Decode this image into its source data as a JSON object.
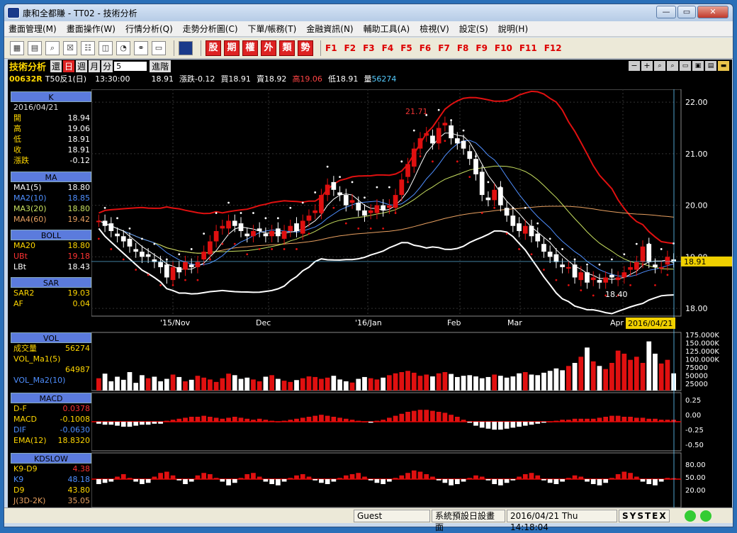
{
  "window": {
    "title": "康和全都賺 - TT02 - 技術分析",
    "min": "—",
    "max": "▭",
    "close": "✕"
  },
  "menus": [
    "畫面管理(M)",
    "畫面操作(W)",
    "行情分析(Q)",
    "走勢分析圖(C)",
    "下單/帳務(T)",
    "金融資訊(N)",
    "輔助工具(A)",
    "檢視(V)",
    "設定(S)",
    "說明(H)"
  ],
  "toolbar": {
    "red_buttons": [
      "股",
      "期",
      "權",
      "外",
      "類",
      "勢"
    ],
    "fkeys": [
      "F1",
      "F2",
      "F3",
      "F4",
      "F5",
      "F6",
      "F7",
      "F8",
      "F9",
      "F10",
      "F11",
      "F12"
    ]
  },
  "header": {
    "title": "技術分析",
    "tabs": [
      "還",
      "日",
      "週",
      "月",
      "分"
    ],
    "period_value": "5",
    "advanced": "進階"
  },
  "quote": {
    "code": "00632R",
    "name": "T50反1(日)",
    "time": "13:30:00",
    "price": "18.91",
    "change": "漲跌-0.12",
    "bid": "買18.91",
    "ask": "賣18.92",
    "high": "高19.06",
    "low": "低18.91",
    "volume_label": "量",
    "volume": "56274"
  },
  "colors": {
    "up": "#e01010",
    "down": "#ffffff",
    "ma1": "#ffffff",
    "ma2": "#4f8fff",
    "ma3": "#c8e060",
    "ma4": "#e8a060",
    "boll": "#e01010",
    "sar": "#ffffff",
    "label_bg": "#f0d000"
  },
  "side": {
    "k": {
      "head": "K",
      "date": "2016/04/21",
      "rows": [
        [
          "開",
          "18.94"
        ],
        [
          "高",
          "19.06"
        ],
        [
          "低",
          "18.91"
        ],
        [
          "收",
          "18.91"
        ],
        [
          "漲跌",
          "-0.12"
        ]
      ]
    },
    "ma": {
      "head": "MA",
      "rows": [
        [
          "MA1(5)",
          "18.80"
        ],
        [
          "MA2(10)",
          "18.85"
        ],
        [
          "MA3(20)",
          "18.80"
        ],
        [
          "MA4(60)",
          "19.42"
        ]
      ]
    },
    "boll": {
      "head": "BOLL",
      "rows": [
        [
          "MA20",
          "18.80"
        ],
        [
          "UBt",
          "19.18"
        ],
        [
          "LBt",
          "18.43"
        ]
      ]
    },
    "sar": {
      "head": "SAR",
      "rows": [
        [
          "SAR2",
          "19.03"
        ],
        [
          "AF",
          "0.04"
        ]
      ]
    },
    "vol": {
      "head": "VOL",
      "rows": [
        [
          "成交量",
          "56274"
        ],
        [
          "VOL_Ma1(5)",
          ""
        ],
        [
          "",
          "64987"
        ],
        [
          "VOL_Ma2(10)",
          ""
        ]
      ]
    },
    "macd": {
      "head": "MACD",
      "rows": [
        [
          "D-F",
          "0.0378"
        ],
        [
          "MACD",
          "-0.1008"
        ],
        [
          "DIF",
          "-0.0630"
        ],
        [
          "EMA(12)",
          "18.8320"
        ]
      ]
    },
    "kd": {
      "head": "KDSLOW",
      "rows": [
        [
          "K9-D9",
          "4.38"
        ],
        [
          "K9",
          "48.18"
        ],
        [
          "D9",
          "43.80"
        ],
        [
          "J(3D-2K)",
          "35.05"
        ]
      ]
    }
  },
  "chart_data": {
    "type": "candlestick",
    "price_axis": [
      "22.00",
      "21.00",
      "20.00",
      "19.00",
      "18.00"
    ],
    "price_range": [
      17.85,
      22.25
    ],
    "x_labels": [
      "'15/Nov",
      "Dec",
      "'16/Jan",
      "Feb",
      "Mar",
      "Apr"
    ],
    "cursor_date": "2016/04/21",
    "current_price": "18.91",
    "annotations": [
      {
        "text": "21.71"
      },
      {
        "text": "18.40"
      }
    ],
    "vol_axis": [
      "175.000K",
      "150.000K",
      "125.000K",
      "100.000K",
      "75000",
      "50000",
      "25000"
    ],
    "macd_axis": [
      "0.25",
      "0.00",
      "-0.25",
      "-0.50"
    ],
    "kd_axis": [
      "80.00",
      "50.00",
      "20.00"
    ],
    "closes": [
      19.7,
      19.6,
      19.5,
      19.4,
      19.3,
      19.2,
      19.1,
      19.0,
      19.0,
      18.9,
      18.8,
      18.6,
      18.8,
      18.7,
      18.9,
      18.8,
      18.9,
      19.1,
      19.3,
      19.5,
      19.6,
      19.7,
      19.6,
      19.5,
      19.4,
      19.5,
      19.5,
      19.4,
      19.5,
      19.4,
      19.5,
      19.6,
      19.5,
      19.7,
      19.8,
      19.9,
      20.2,
      20.4,
      20.3,
      20.2,
      20.0,
      20.1,
      19.9,
      19.8,
      19.9,
      20.0,
      19.9,
      20.0,
      20.2,
      20.5,
      20.8,
      21.1,
      21.3,
      21.4,
      21.2,
      21.5,
      21.6,
      21.3,
      21.2,
      21.1,
      20.9,
      20.6,
      20.2,
      20.1,
      20.3,
      20.0,
      19.8,
      19.6,
      19.5,
      19.6,
      19.4,
      19.3,
      19.1,
      19.0,
      18.9,
      18.8,
      18.8,
      18.6,
      18.7,
      18.5,
      18.6,
      18.5,
      18.6,
      18.6,
      18.6,
      18.7,
      18.8,
      18.9,
      19.2,
      18.9,
      18.8,
      18.8,
      19.0,
      18.91
    ],
    "volumes": [
      40,
      55,
      30,
      45,
      35,
      60,
      25,
      50,
      40,
      45,
      30,
      38,
      52,
      44,
      30,
      35,
      48,
      42,
      36,
      28,
      40,
      55,
      50,
      38,
      42,
      36,
      30,
      45,
      50,
      38,
      32,
      28,
      34,
      40,
      46,
      44,
      38,
      42,
      48,
      36,
      30,
      26,
      38,
      44,
      40,
      36,
      42,
      50,
      56,
      60,
      64,
      58,
      48,
      52,
      46,
      56,
      60,
      54,
      44,
      48,
      50,
      46,
      40,
      44,
      52,
      48,
      42,
      46,
      56,
      60,
      52,
      50,
      58,
      64,
      72,
      66,
      80,
      90,
      110,
      140,
      95,
      80,
      70,
      90,
      130,
      120,
      100,
      110,
      90,
      160,
      120,
      88,
      100,
      56
    ],
    "macd_bars": [
      -0.02,
      -0.03,
      -0.03,
      -0.04,
      -0.05,
      -0.05,
      -0.04,
      -0.03,
      -0.03,
      -0.02,
      -0.02,
      0.01,
      0.02,
      0.03,
      0.04,
      0.05,
      0.05,
      0.06,
      0.05,
      0.04,
      0.03,
      0.04,
      0.05,
      0.04,
      0.03,
      0.02,
      0.03,
      0.02,
      0.01,
      0.0,
      0.01,
      0.02,
      0.03,
      0.04,
      0.05,
      0.06,
      0.07,
      0.06,
      0.05,
      0.04,
      0.03,
      0.02,
      0.01,
      0.0,
      -0.01,
      0.01,
      0.02,
      0.04,
      0.06,
      0.08,
      0.1,
      0.11,
      0.12,
      0.12,
      0.11,
      0.1,
      0.09,
      0.07,
      0.05,
      0.02,
      -0.01,
      -0.04,
      -0.06,
      -0.07,
      -0.08,
      -0.08,
      -0.07,
      -0.06,
      -0.05,
      -0.04,
      -0.03,
      -0.02,
      -0.01,
      0.0,
      0.01,
      0.02,
      0.02,
      0.03,
      0.03,
      0.03,
      0.03,
      0.04,
      0.05,
      0.06,
      0.06,
      0.05,
      0.05,
      0.04,
      0.04,
      0.03,
      0.03,
      0.02,
      0.02,
      0.02
    ],
    "kd_bars": [
      -20,
      -15,
      -10,
      10,
      20,
      5,
      -10,
      -20,
      -15,
      10,
      25,
      30,
      15,
      -5,
      -20,
      -10,
      15,
      25,
      20,
      5,
      -10,
      -25,
      -15,
      5,
      20,
      25,
      10,
      -10,
      -20,
      -25,
      -10,
      5,
      15,
      20,
      10,
      -5,
      -15,
      -20,
      -10,
      5,
      15,
      20,
      25,
      10,
      -5,
      -15,
      -20,
      -10,
      5,
      15,
      25,
      35,
      30,
      20,
      10,
      -5,
      -15,
      -25,
      -20,
      -10,
      5,
      15,
      10,
      -5,
      -20,
      -25,
      -15,
      -5,
      10,
      20,
      25,
      15,
      -5,
      -15,
      -20,
      -10,
      5,
      15,
      10,
      -10,
      -20,
      -25,
      -15,
      5,
      20,
      30,
      25,
      10,
      -10,
      -20,
      -25,
      -10,
      5,
      4
    ]
  },
  "status": {
    "user": "Guest",
    "profile": "系統預設日設畫面",
    "datetime": "2016/04/21 Thu 14:18:04",
    "brand": "SYSTEX"
  }
}
